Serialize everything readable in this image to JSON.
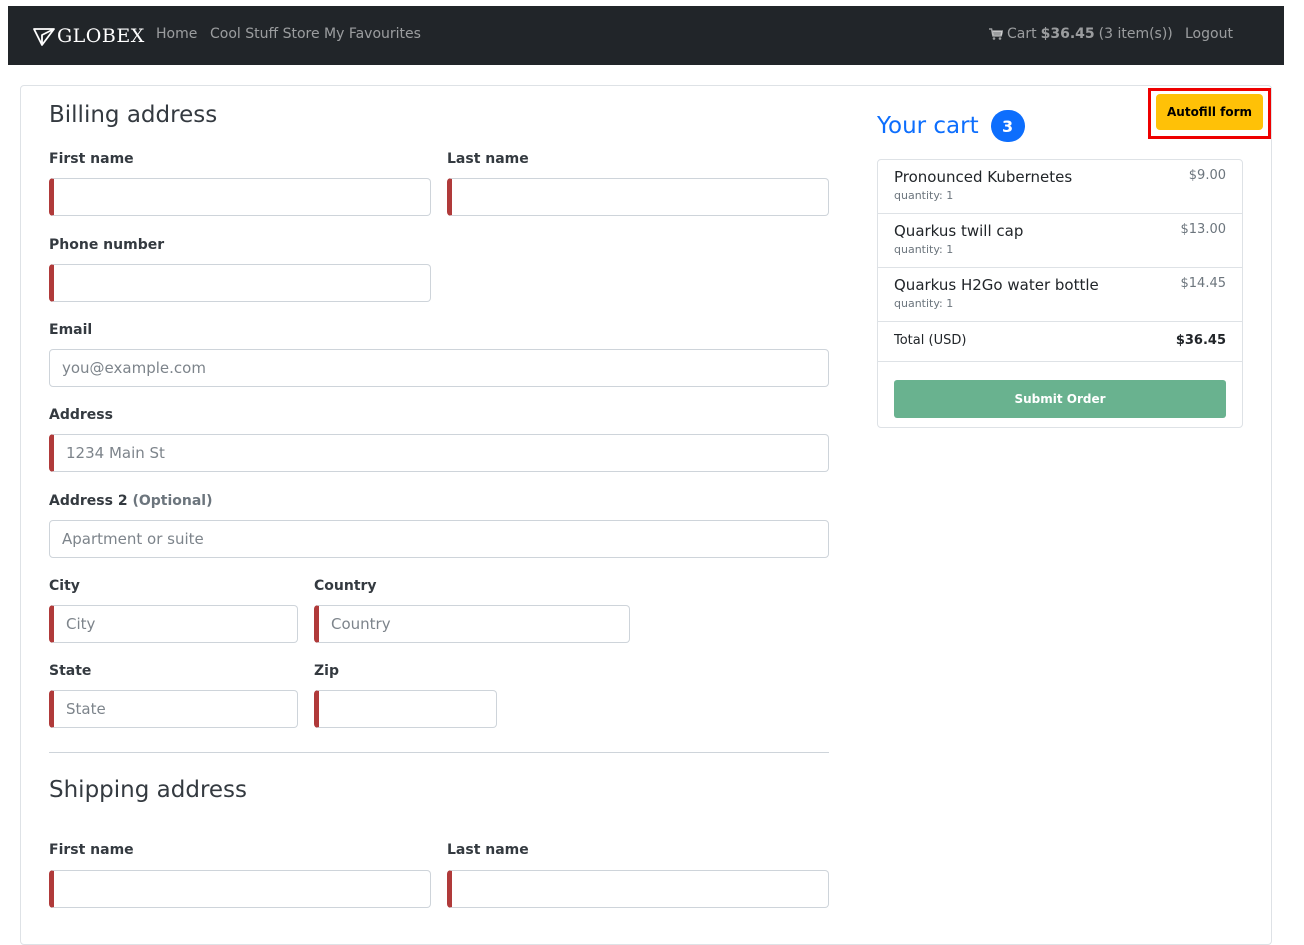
{
  "navbar": {
    "brand": "GLOBEX",
    "links": [
      "Home",
      "Cool Stuff Store",
      "My Favourites"
    ],
    "cart": {
      "label": "Cart",
      "amount": "$36.45",
      "count_text": "(3 item(s))"
    },
    "logout": "Logout",
    "icons": {
      "brand": "globex-logo-icon",
      "cart": "shopping-cart-icon"
    }
  },
  "billing": {
    "title": "Billing address",
    "first_name": {
      "label": "First name",
      "value": "",
      "placeholder": ""
    },
    "last_name": {
      "label": "Last name",
      "value": "",
      "placeholder": ""
    },
    "phone": {
      "label": "Phone number",
      "value": "",
      "placeholder": ""
    },
    "email": {
      "label": "Email",
      "value": "",
      "placeholder": "you@example.com"
    },
    "address": {
      "label": "Address",
      "value": "",
      "placeholder": "1234 Main St"
    },
    "address2": {
      "label": "Address 2",
      "optional": "(Optional)",
      "value": "",
      "placeholder": "Apartment or suite"
    },
    "city": {
      "label": "City",
      "value": "",
      "placeholder": "City"
    },
    "country": {
      "label": "Country",
      "value": "",
      "placeholder": "Country"
    },
    "state": {
      "label": "State",
      "value": "",
      "placeholder": "State"
    },
    "zip": {
      "label": "Zip",
      "value": "",
      "placeholder": ""
    }
  },
  "shipping": {
    "title": "Shipping address",
    "first_name": {
      "label": "First name",
      "value": "",
      "placeholder": ""
    },
    "last_name": {
      "label": "Last name",
      "value": "",
      "placeholder": ""
    }
  },
  "cart": {
    "title": "Your cart",
    "badge": "3",
    "autofill_label": "Autofill form",
    "items": [
      {
        "name": "Pronounced Kubernetes",
        "quantity": "quantity: 1",
        "price": "$9.00"
      },
      {
        "name": "Quarkus twill cap",
        "quantity": "quantity: 1",
        "price": "$13.00"
      },
      {
        "name": "Quarkus H2Go water bottle",
        "quantity": "quantity: 1",
        "price": "$14.45"
      }
    ],
    "total_label": "Total (USD)",
    "total_value": "$36.45",
    "submit_label": "Submit Order"
  },
  "colors": {
    "navbar_bg": "#212529",
    "accent_blue": "#0d6efd",
    "autofill_yellow": "#ffc107",
    "highlight_red": "#ee0000",
    "invalid_red": "#b03a3a",
    "submit_green": "#69b28f"
  }
}
